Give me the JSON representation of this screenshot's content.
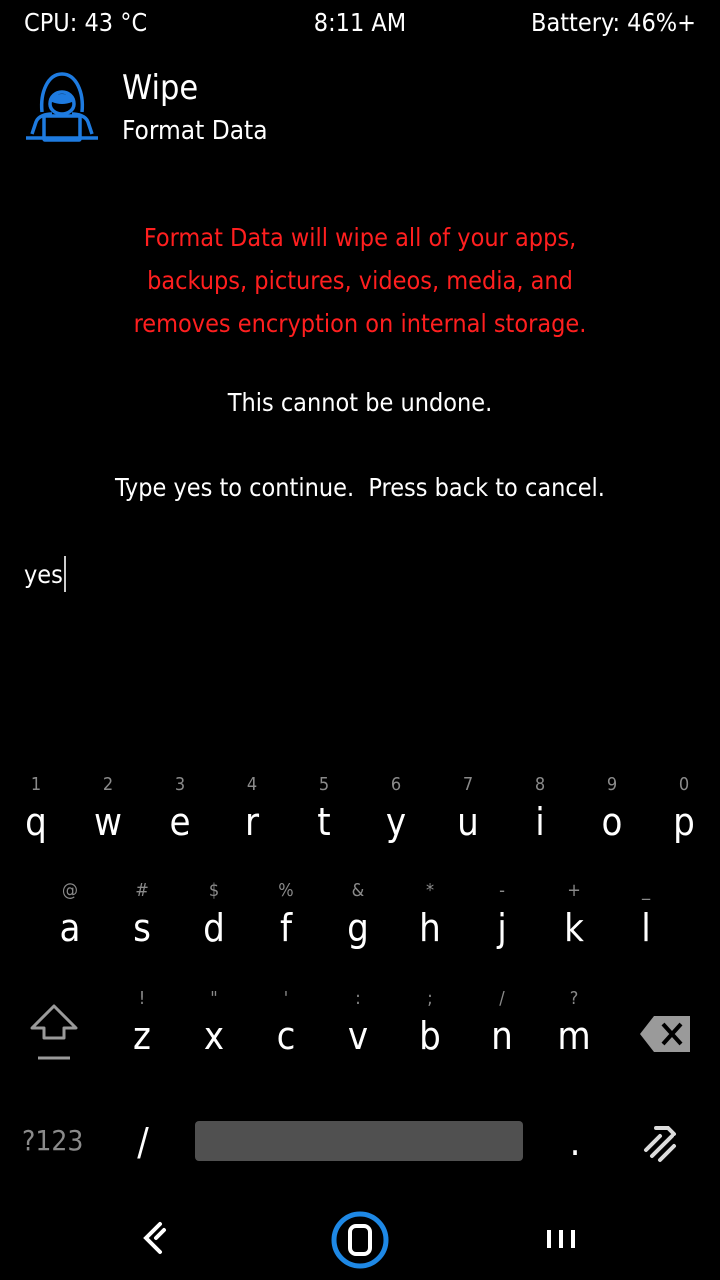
{
  "status_bar": {
    "cpu": "CPU: 43 °C",
    "time": "8:11 AM",
    "battery": "Battery: 46%+"
  },
  "header": {
    "title": "Wipe",
    "subtitle": "Format Data",
    "logo_icon": "hacker-logo-icon",
    "accent_color": "#1e7be0"
  },
  "warning": {
    "lines": [
      "Format Data will wipe all of your apps,",
      "backups, pictures, videos, media, and",
      "removes encryption on internal storage."
    ],
    "color": "#ff1f1f"
  },
  "notice": "This cannot be undone.",
  "prompt": "Type yes to continue.  Press back to cancel.",
  "input": {
    "value": "yes"
  },
  "keyboard": {
    "rows": [
      {
        "keys": [
          {
            "hint": "1",
            "key": "q"
          },
          {
            "hint": "2",
            "key": "w"
          },
          {
            "hint": "3",
            "key": "e"
          },
          {
            "hint": "4",
            "key": "r"
          },
          {
            "hint": "5",
            "key": "t"
          },
          {
            "hint": "6",
            "key": "y"
          },
          {
            "hint": "7",
            "key": "u"
          },
          {
            "hint": "8",
            "key": "i"
          },
          {
            "hint": "9",
            "key": "o"
          },
          {
            "hint": "0",
            "key": "p"
          }
        ]
      },
      {
        "keys": [
          {
            "hint": "@",
            "key": "a"
          },
          {
            "hint": "#",
            "key": "s"
          },
          {
            "hint": "$",
            "key": "d"
          },
          {
            "hint": "%",
            "key": "f"
          },
          {
            "hint": "&",
            "key": "g"
          },
          {
            "hint": "*",
            "key": "h"
          },
          {
            "hint": "-",
            "key": "j"
          },
          {
            "hint": "+",
            "key": "k"
          },
          {
            "hint": "_",
            "key": "l"
          }
        ]
      },
      {
        "keys": [
          {
            "hint": "!",
            "key": "z"
          },
          {
            "hint": "\"",
            "key": "x"
          },
          {
            "hint": "'",
            "key": "c"
          },
          {
            "hint": ":",
            "key": "v"
          },
          {
            "hint": ";",
            "key": "b"
          },
          {
            "hint": "/",
            "key": "n"
          },
          {
            "hint": "?",
            "key": "m"
          }
        ]
      }
    ],
    "symbols_label": "?123",
    "slash_label": "/",
    "period_label": ".",
    "icons": {
      "shift": "shift-icon",
      "delete": "backspace-icon",
      "enter": "enter-icon"
    }
  },
  "nav": {
    "back": "back-icon",
    "home": "home-icon",
    "recents": "recents-icon",
    "home_ring_color": "#1e88e5"
  }
}
